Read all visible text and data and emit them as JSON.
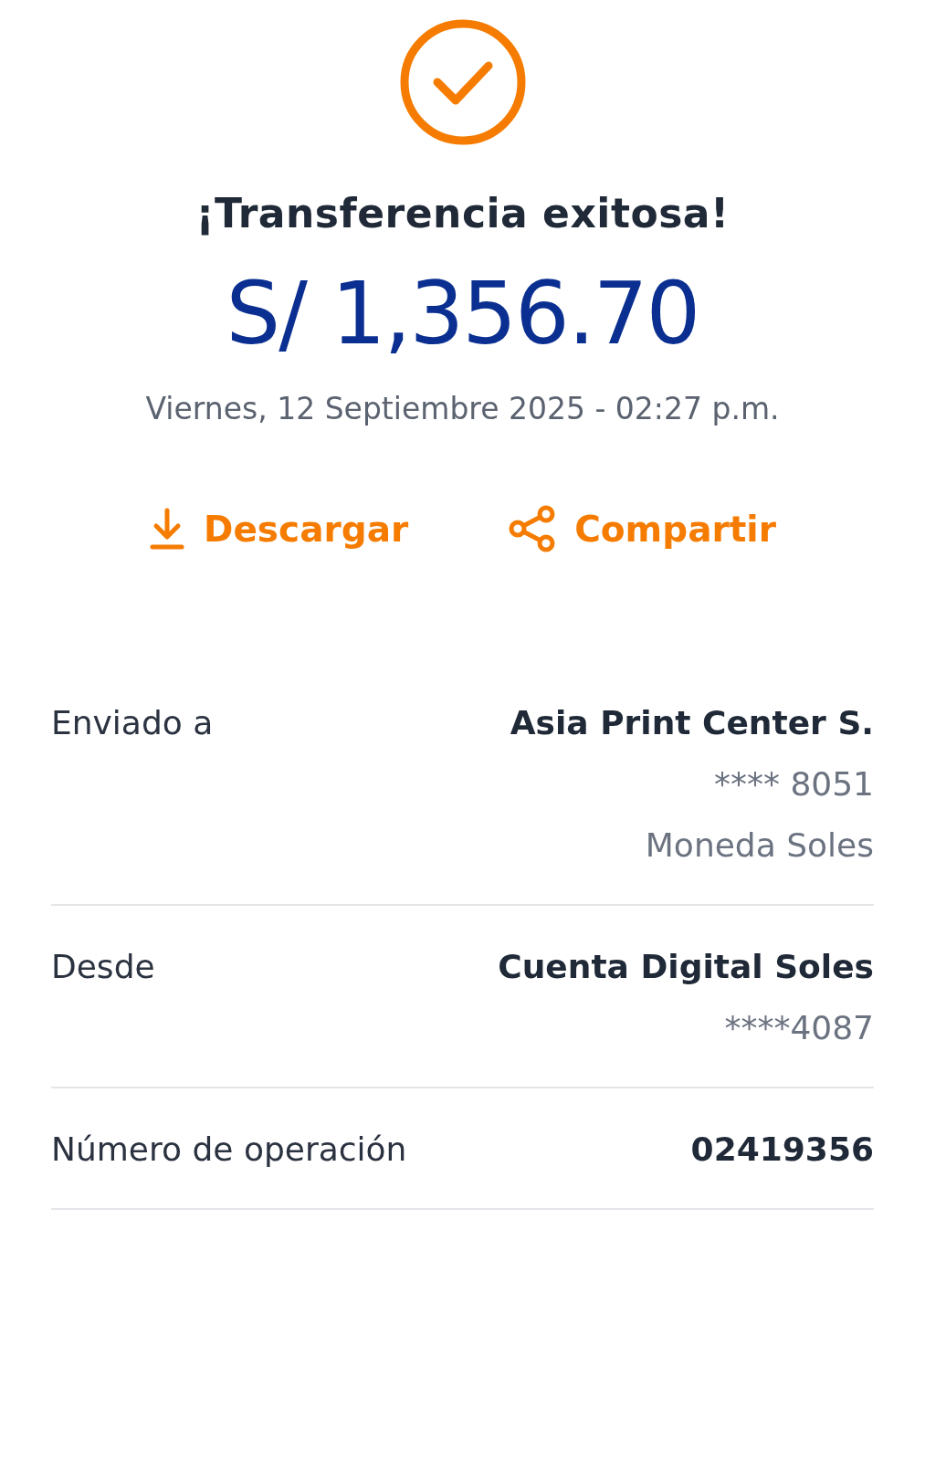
{
  "status": {
    "kind": "success"
  },
  "title": "¡Transferencia exitosa!",
  "amount": "S/ 1,356.70",
  "datetime": "Viernes, 12 Septiembre 2025 - 02:27 p.m.",
  "actions": [
    {
      "kind": "download",
      "label": "Descargar"
    },
    {
      "kind": "share",
      "label": "Compartir"
    }
  ],
  "details": [
    {
      "label": "Enviado a",
      "values": [
        "Asia Print Center S.",
        "**** 8051",
        "Moneda Soles"
      ]
    },
    {
      "label": "Desde",
      "values": [
        "Cuenta Digital Soles",
        "****4087"
      ]
    },
    {
      "label": "Número de operación",
      "values": [
        "02419356"
      ]
    }
  ]
}
